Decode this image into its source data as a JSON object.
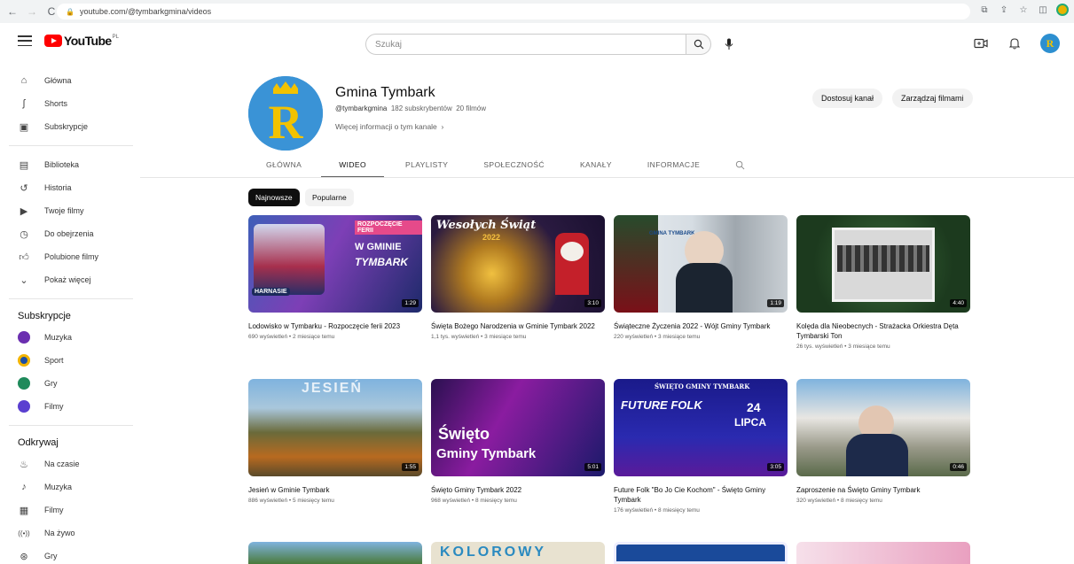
{
  "browser": {
    "url": "youtube.com/@tymbarkgmina/videos"
  },
  "header": {
    "logo_text": "YouTube",
    "logo_country": "PL",
    "search_placeholder": "Szukaj"
  },
  "sidebar": {
    "main": [
      {
        "label": "Główna",
        "icon": "home-icon"
      },
      {
        "label": "Shorts",
        "icon": "shorts-icon"
      },
      {
        "label": "Subskrypcje",
        "icon": "subscriptions-icon"
      }
    ],
    "library": [
      {
        "label": "Biblioteka",
        "icon": "library-icon"
      },
      {
        "label": "Historia",
        "icon": "history-icon"
      },
      {
        "label": "Twoje filmy",
        "icon": "your-videos-icon"
      },
      {
        "label": "Do obejrzenia",
        "icon": "watch-later-icon"
      },
      {
        "label": "Polubione filmy",
        "icon": "like-icon"
      },
      {
        "label": "Pokaż więcej",
        "icon": "chevron-down-icon"
      }
    ],
    "subscriptions_heading": "Subskrypcje",
    "subscriptions": [
      {
        "label": "Muzyka",
        "color": "#6b2fb0"
      },
      {
        "label": "Sport",
        "color": "#1d4fa6"
      },
      {
        "label": "Gry",
        "color": "#1f8a5b"
      },
      {
        "label": "Filmy",
        "color": "#5a3fd0"
      }
    ],
    "explore_heading": "Odkrywaj",
    "explore": [
      {
        "label": "Na czasie",
        "icon": "trending-icon"
      },
      {
        "label": "Muzyka",
        "icon": "music-icon"
      },
      {
        "label": "Filmy",
        "icon": "film-icon"
      },
      {
        "label": "Na żywo",
        "icon": "live-icon"
      },
      {
        "label": "Gry",
        "icon": "gaming-icon"
      }
    ]
  },
  "channel": {
    "name": "Gmina Tymbark",
    "handle": "@tymbarkgmina",
    "subscribers": "182 subskrybentów",
    "videos_count": "20 filmów",
    "more_info": "Więcej informacji o tym kanale",
    "customize_button": "Dostosuj kanał",
    "manage_button": "Zarządzaj filmami"
  },
  "tabs": [
    "GŁÓWNA",
    "WIDEO",
    "PLAYLISTY",
    "SPOŁECZNOŚĆ",
    "KANAŁY",
    "INFORMACJE"
  ],
  "active_tab": "WIDEO",
  "chips": {
    "newest": "Najnowsze",
    "popular": "Popularne"
  },
  "videos": [
    {
      "title": "Lodowisko w Tymbarku - Rozpoczęcie ferii 2023",
      "meta": "690 wyświetleń • 2 miesiące temu",
      "duration": "1:29"
    },
    {
      "title": "Święta Bożego Narodzenia w Gminie Tymbark 2022",
      "meta": "1,1 tys. wyświetleń • 3 miesiące temu",
      "duration": "3:10"
    },
    {
      "title": "Świąteczne Życzenia 2022 - Wójt Gminy Tymbark",
      "meta": "220 wyświetleń • 3 miesiące temu",
      "duration": "1:19"
    },
    {
      "title": "Kolęda dla Nieobecnych - Strażacka Orkiestra Dęta Tymbarski Ton",
      "meta": "26 tys. wyświetleń • 3 miesiące temu",
      "duration": "4:40"
    },
    {
      "title": "Jesień w Gminie Tymbark",
      "meta": "886 wyświetleń • 5 miesięcy temu",
      "duration": "1:55"
    },
    {
      "title": "Święto Gminy Tymbark 2022",
      "meta": "968 wyświetleń • 8 miesięcy temu",
      "duration": "5:01"
    },
    {
      "title": "Future Folk \"Bo Jo Cie Kochom\" - Święto Gminy Tymbark",
      "meta": "176 wyświetleń • 8 miesięcy temu",
      "duration": "3:05"
    },
    {
      "title": "Zaproszenie na Święto Gminy Tymbark",
      "meta": "320 wyświetleń • 8 miesięcy temu",
      "duration": "0:46"
    }
  ],
  "thumb_text": {
    "t1_top": "ROZPOCZĘCIE FERII",
    "t1_mid": "W GMINIE",
    "t1_bot": "TYMBARK",
    "t1_badge": "HARNASIE",
    "t2": "Wesołych Świąt",
    "t2_year": "2022",
    "t3_top": "GMINA TYMBARK",
    "t5": "JESIEŃ",
    "t6_a": "Święto",
    "t6_b": "Gminy Tymbark",
    "t7_top": "ŚWIĘTO GMINY TYMBARK",
    "t7_a": "FUTURE FOLK",
    "t7_day": "24",
    "t7_month": "LIPCA",
    "t9": "KOLOROWY"
  }
}
